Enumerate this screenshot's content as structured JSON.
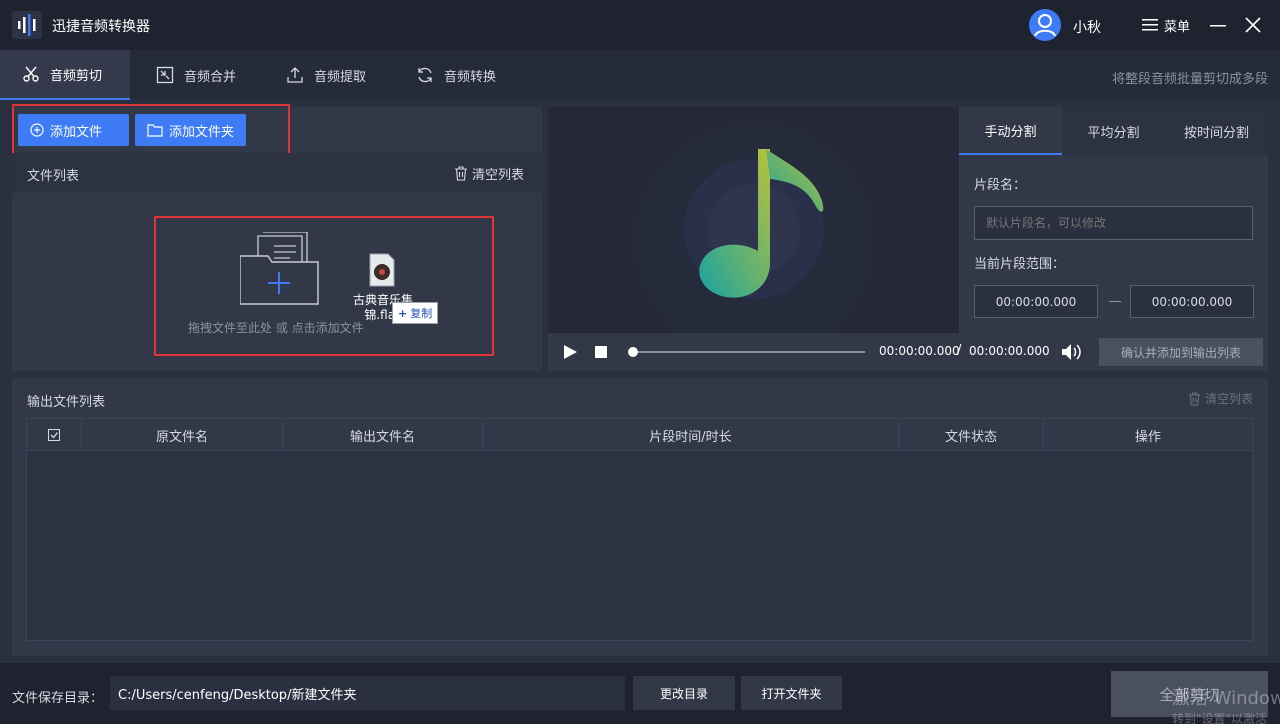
{
  "titlebar": {
    "app_title": "迅捷音频转换器",
    "username": "小秋",
    "menu_label": "菜单"
  },
  "tabs": {
    "items": [
      {
        "label": "音频剪切",
        "icon": "scissors-icon"
      },
      {
        "label": "音频合并",
        "icon": "merge-icon"
      },
      {
        "label": "音频提取",
        "icon": "extract-icon"
      },
      {
        "label": "音频转换",
        "icon": "convert-icon"
      }
    ],
    "active": 0,
    "hint": "将整段音频批量剪切成多段"
  },
  "file_panel": {
    "add_file": "添加文件",
    "add_folder": "添加文件夹",
    "list_title": "文件列表",
    "clear": "清空列表",
    "drop_hint": "拖拽文件至此处 或 点击添加文件",
    "dragged_file_name": "古典音乐集锦.flac",
    "copy_tip": "复制"
  },
  "player": {
    "current_time": "00:00:00.000",
    "separator": "/",
    "total_time": "00:00:00.000",
    "confirm": "确认并添加到输出列表",
    "progress": 0
  },
  "split": {
    "tabs": [
      "手动分割",
      "平均分割",
      "按时间分割"
    ],
    "active": 0,
    "seg_name_label": "片段名：",
    "seg_name_placeholder": "默认片段名，可以修改",
    "range_label": "当前片段范围：",
    "range_start": "00:00:00.000",
    "range_end": "00:00:00.000"
  },
  "output": {
    "title": "输出文件列表",
    "clear": "清空列表",
    "columns": [
      "原文件名",
      "输出文件名",
      "片段时间/时长",
      "文件状态",
      "操作"
    ]
  },
  "bottom": {
    "save_label": "文件保存目录：",
    "save_path": "C:/Users/cenfeng/Desktop/新建文件夹",
    "change_dir": "更改目录",
    "open_folder": "打开文件夹",
    "cut_all": "全部剪切",
    "watermark": "激活 Windows",
    "watermark_sub": "转到\"设置\"以激活"
  },
  "colors": {
    "accent": "#3d7cf5",
    "highlight_box": "#e03535",
    "background": "#2b3040"
  }
}
